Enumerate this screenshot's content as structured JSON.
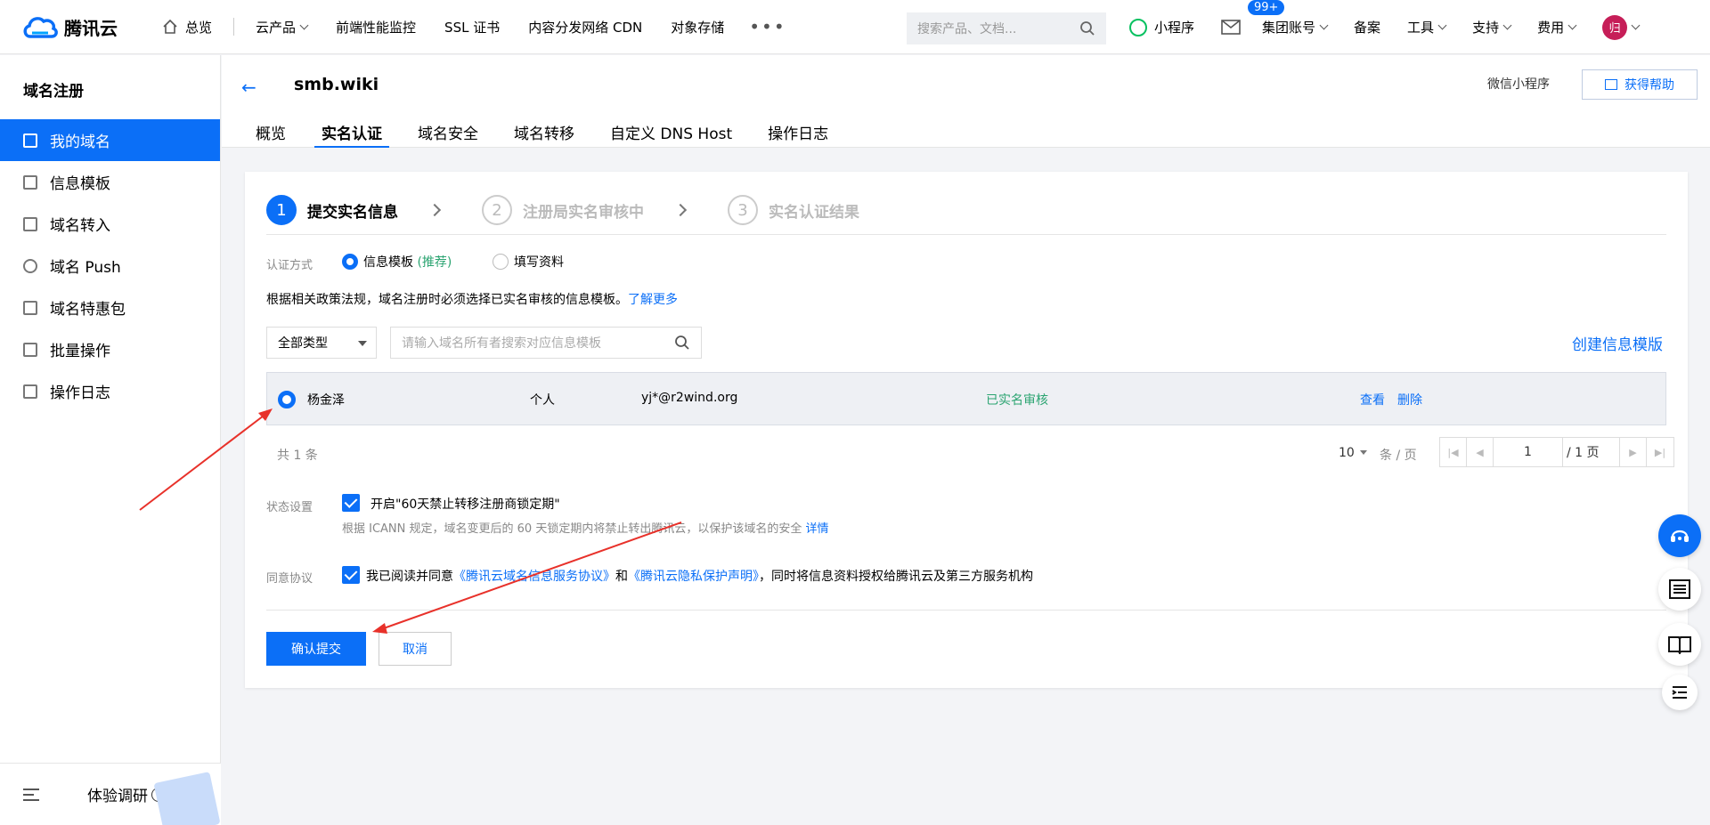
{
  "topnav": {
    "brand": "腾讯云",
    "home": "总览",
    "items": [
      "云产品",
      "前端性能监控",
      "SSL 证书",
      "内容分发网络 CDN",
      "对象存储"
    ],
    "more": "•••",
    "search_placeholder": "搜索产品、文档...",
    "mini_program": "小程序",
    "mail_badge": "99+",
    "right_items": [
      "集团账号",
      "备案",
      "工具",
      "支持",
      "费用"
    ],
    "avatar_text": "归"
  },
  "sidebar": {
    "title": "域名注册",
    "items": [
      {
        "label": "我的域名",
        "active": true
      },
      {
        "label": "信息模板",
        "active": false
      },
      {
        "label": "域名转入",
        "active": false
      },
      {
        "label": "域名 Push",
        "active": false
      },
      {
        "label": "域名特惠包",
        "active": false
      },
      {
        "label": "批量操作",
        "active": false
      },
      {
        "label": "操作日志",
        "active": false
      }
    ],
    "survey": "体验调研",
    "help_icon": "?"
  },
  "header": {
    "back_icon": "←",
    "domain": "smb.wiki",
    "wx_link": "微信小程序",
    "help_button": "获得帮助",
    "tabs": [
      "概览",
      "实名认证",
      "域名安全",
      "域名转移",
      "自定义 DNS Host",
      "操作日志"
    ],
    "active_tab": "实名认证"
  },
  "steps": [
    {
      "num": "1",
      "label": "提交实名信息"
    },
    {
      "num": "2",
      "label": "注册局实名审核中"
    },
    {
      "num": "3",
      "label": "实名认证结果"
    }
  ],
  "auth": {
    "label": "认证方式",
    "option1": "信息模板",
    "option1_tag": "(推荐)",
    "option2": "填写资料"
  },
  "policy": {
    "text": "根据相关政策法规，域名注册时必须选择已实名审核的信息模板。",
    "link": "了解更多"
  },
  "filter": {
    "type_select": "全部类型",
    "search_placeholder": "请输入域名所有者搜索对应信息模板",
    "create_link": "创建信息模版"
  },
  "table": {
    "rows": [
      {
        "name": "杨金泽",
        "type": "个人",
        "email": "yj*@r2wind.org",
        "status": "已实名审核",
        "actions": [
          "查看",
          "删除"
        ]
      }
    ]
  },
  "pager": {
    "total": "共 1 条",
    "page_size": "10",
    "per_page": "条 / 页",
    "current_page": "1",
    "total_pages": "/ 1 页"
  },
  "lock": {
    "label": "状态设置",
    "checkbox_text": "开启\"60天禁止转移注册商锁定期\"",
    "note": "根据 ICANN 规定，域名变更后的 60 天锁定期内将禁止转出腾讯云，以保护该域名的安全",
    "note_link": "详情"
  },
  "agreement": {
    "label": "同意协议",
    "prefix": "我已阅读并同意",
    "link1": "《腾讯云域名信息服务协议》",
    "and": "和",
    "link2": "《腾讯云隐私保护声明》",
    "suffix": "，同时将信息资料授权给腾讯云及第三方服务机构"
  },
  "buttons": {
    "submit": "确认提交",
    "cancel": "取消"
  },
  "colors": {
    "accent": "#0b6ff7",
    "success": "#2ba471",
    "arrow": "#e8312a"
  }
}
